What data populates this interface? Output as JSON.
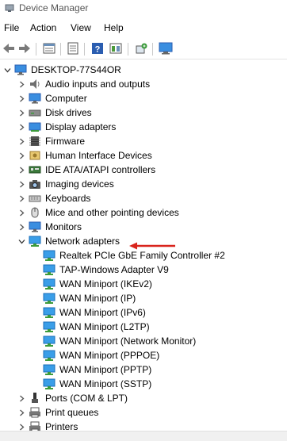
{
  "window": {
    "title": "Device Manager"
  },
  "menu": [
    {
      "name": "menu-file",
      "label": "File"
    },
    {
      "name": "menu-action",
      "label": "Action"
    },
    {
      "name": "menu-view",
      "label": "View"
    },
    {
      "name": "menu-help",
      "label": "Help"
    }
  ],
  "toolbar": {
    "buttons": [
      "back-icon",
      "forward-icon",
      "properties-icon",
      "update-driver-icon",
      "help-icon",
      "show-view-icon",
      "scan-hardware-icon",
      "monitor-icon"
    ]
  },
  "tree": {
    "root": {
      "label": "DESKTOP-77S44OR",
      "expanded": true
    },
    "categories": [
      {
        "label": "Audio inputs and outputs",
        "icon": "speaker-icon",
        "expanded": false
      },
      {
        "label": "Computer",
        "icon": "computer-icon",
        "expanded": false
      },
      {
        "label": "Disk drives",
        "icon": "disk-drive-icon",
        "expanded": false
      },
      {
        "label": "Display adapters",
        "icon": "display-adapter-icon",
        "expanded": false
      },
      {
        "label": "Firmware",
        "icon": "firmware-icon",
        "expanded": false
      },
      {
        "label": "Human Interface Devices",
        "icon": "hid-icon",
        "expanded": false
      },
      {
        "label": "IDE ATA/ATAPI controllers",
        "icon": "ide-controller-icon",
        "expanded": false
      },
      {
        "label": "Imaging devices",
        "icon": "camera-icon",
        "expanded": false
      },
      {
        "label": "Keyboards",
        "icon": "keyboard-icon",
        "expanded": false
      },
      {
        "label": "Mice and other pointing devices",
        "icon": "mouse-icon",
        "expanded": false
      },
      {
        "label": "Monitors",
        "icon": "monitor-icon",
        "expanded": false
      },
      {
        "label": "Network adapters",
        "icon": "network-adapter-icon",
        "expanded": true
      }
    ],
    "network_children": [
      "Realtek PCIe GbE Family Controller #2",
      "TAP-Windows Adapter V9",
      "WAN Miniport (IKEv2)",
      "WAN Miniport (IP)",
      "WAN Miniport (IPv6)",
      "WAN Miniport (L2TP)",
      "WAN Miniport (Network Monitor)",
      "WAN Miniport (PPPOE)",
      "WAN Miniport (PPTP)",
      "WAN Miniport (SSTP)"
    ],
    "after": [
      {
        "label": "Ports (COM & LPT)",
        "icon": "port-icon",
        "expanded": false
      },
      {
        "label": "Print queues",
        "icon": "print-queue-icon",
        "expanded": false
      },
      {
        "label": "Printers",
        "icon": "printer-icon",
        "expanded": false
      }
    ]
  },
  "annotation": {
    "color": "#d9241c"
  },
  "colors": {
    "network_icon": "#1e88d8",
    "accent": "#0a64ad"
  }
}
